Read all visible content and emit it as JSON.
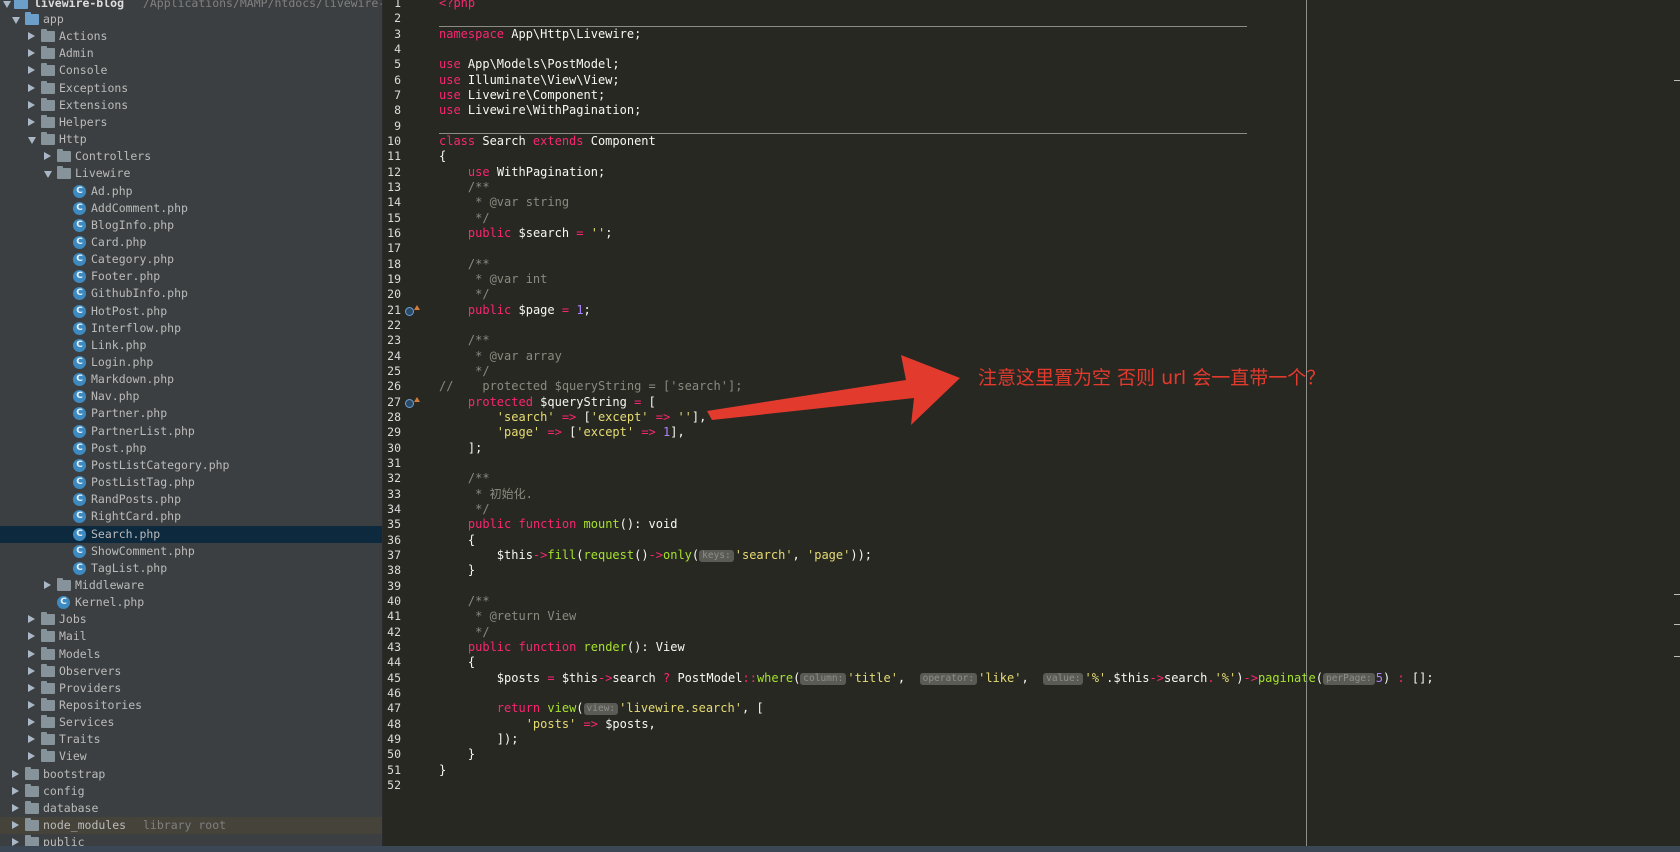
{
  "project": {
    "name": "livewire-blog",
    "path": "/Applications/MAMP/htdocs/livewire-blog"
  },
  "tree": [
    {
      "label": "app",
      "type": "folder",
      "depth": 0,
      "open": true
    },
    {
      "label": "Actions",
      "type": "folder",
      "depth": 1
    },
    {
      "label": "Admin",
      "type": "folder",
      "depth": 1
    },
    {
      "label": "Console",
      "type": "folder",
      "depth": 1
    },
    {
      "label": "Exceptions",
      "type": "folder",
      "depth": 1
    },
    {
      "label": "Extensions",
      "type": "folder",
      "depth": 1
    },
    {
      "label": "Helpers",
      "type": "folder",
      "depth": 1
    },
    {
      "label": "Http",
      "type": "folder",
      "depth": 1,
      "open": true
    },
    {
      "label": "Controllers",
      "type": "folder",
      "depth": 2
    },
    {
      "label": "Livewire",
      "type": "folder",
      "depth": 2,
      "open": true
    },
    {
      "label": "Ad.php",
      "type": "file",
      "depth": 3
    },
    {
      "label": "AddComment.php",
      "type": "file",
      "depth": 3
    },
    {
      "label": "BlogInfo.php",
      "type": "file",
      "depth": 3
    },
    {
      "label": "Card.php",
      "type": "file",
      "depth": 3
    },
    {
      "label": "Category.php",
      "type": "file",
      "depth": 3
    },
    {
      "label": "Footer.php",
      "type": "file",
      "depth": 3
    },
    {
      "label": "GithubInfo.php",
      "type": "file",
      "depth": 3
    },
    {
      "label": "HotPost.php",
      "type": "file",
      "depth": 3
    },
    {
      "label": "Interflow.php",
      "type": "file",
      "depth": 3
    },
    {
      "label": "Link.php",
      "type": "file",
      "depth": 3
    },
    {
      "label": "Login.php",
      "type": "file",
      "depth": 3
    },
    {
      "label": "Markdown.php",
      "type": "file",
      "depth": 3
    },
    {
      "label": "Nav.php",
      "type": "file",
      "depth": 3
    },
    {
      "label": "Partner.php",
      "type": "file",
      "depth": 3
    },
    {
      "label": "PartnerList.php",
      "type": "file",
      "depth": 3
    },
    {
      "label": "Post.php",
      "type": "file",
      "depth": 3
    },
    {
      "label": "PostListCategory.php",
      "type": "file",
      "depth": 3
    },
    {
      "label": "PostListTag.php",
      "type": "file",
      "depth": 3
    },
    {
      "label": "RandPosts.php",
      "type": "file",
      "depth": 3
    },
    {
      "label": "RightCard.php",
      "type": "file",
      "depth": 3
    },
    {
      "label": "Search.php",
      "type": "file",
      "depth": 3,
      "selected": true
    },
    {
      "label": "ShowComment.php",
      "type": "file",
      "depth": 3
    },
    {
      "label": "TagList.php",
      "type": "file",
      "depth": 3
    },
    {
      "label": "Middleware",
      "type": "folder",
      "depth": 2
    },
    {
      "label": "Kernel.php",
      "type": "file",
      "depth": 2
    },
    {
      "label": "Jobs",
      "type": "folder",
      "depth": 1
    },
    {
      "label": "Mail",
      "type": "folder",
      "depth": 1
    },
    {
      "label": "Models",
      "type": "folder",
      "depth": 1
    },
    {
      "label": "Observers",
      "type": "folder",
      "depth": 1
    },
    {
      "label": "Providers",
      "type": "folder",
      "depth": 1
    },
    {
      "label": "Repositories",
      "type": "folder",
      "depth": 1
    },
    {
      "label": "Services",
      "type": "folder",
      "depth": 1
    },
    {
      "label": "Traits",
      "type": "folder",
      "depth": 1
    },
    {
      "label": "View",
      "type": "folder",
      "depth": 1
    },
    {
      "label": "bootstrap",
      "type": "folder",
      "depth": 0
    },
    {
      "label": "config",
      "type": "folder",
      "depth": 0
    },
    {
      "label": "database",
      "type": "folder",
      "depth": 0
    },
    {
      "label": "node_modules",
      "type": "folder",
      "depth": 0,
      "extra": "library root",
      "libroot": true
    },
    {
      "label": "public",
      "type": "folder",
      "depth": 0
    }
  ],
  "code": [
    [
      {
        "t": "<?php",
        "c": "kw"
      }
    ],
    [],
    [
      {
        "t": "namespace",
        "c": "kw"
      },
      {
        "t": " App\\Http\\Livewire;"
      }
    ],
    [],
    [
      {
        "t": "use",
        "c": "kw"
      },
      {
        "t": " App\\Models\\PostModel;"
      }
    ],
    [
      {
        "t": "use",
        "c": "kw"
      },
      {
        "t": " Illuminate\\View\\View;"
      }
    ],
    [
      {
        "t": "use",
        "c": "kw"
      },
      {
        "t": " Livewire\\Component;"
      }
    ],
    [
      {
        "t": "use",
        "c": "kw"
      },
      {
        "t": " Livewire\\WithPagination;"
      }
    ],
    [],
    [
      {
        "t": "class",
        "c": "kw"
      },
      {
        "t": " Search "
      },
      {
        "t": "extends",
        "c": "kw"
      },
      {
        "t": " Component"
      }
    ],
    [
      {
        "t": "{"
      }
    ],
    [
      {
        "t": "    "
      },
      {
        "t": "use",
        "c": "kw"
      },
      {
        "t": " WithPagination;"
      }
    ],
    [
      {
        "t": "    /**",
        "c": "cm"
      }
    ],
    [
      {
        "t": "     * @var string",
        "c": "cm"
      }
    ],
    [
      {
        "t": "     */",
        "c": "cm"
      }
    ],
    [
      {
        "t": "    "
      },
      {
        "t": "public",
        "c": "kw"
      },
      {
        "t": " $search "
      },
      {
        "t": "=",
        "c": "op"
      },
      {
        "t": " "
      },
      {
        "t": "''",
        "c": "str"
      },
      {
        "t": ";"
      }
    ],
    [],
    [
      {
        "t": "    /**",
        "c": "cm"
      }
    ],
    [
      {
        "t": "     * @var int",
        "c": "cm"
      }
    ],
    [
      {
        "t": "     */",
        "c": "cm"
      }
    ],
    [
      {
        "t": "    "
      },
      {
        "t": "public",
        "c": "kw"
      },
      {
        "t": " $page "
      },
      {
        "t": "=",
        "c": "op"
      },
      {
        "t": " "
      },
      {
        "t": "1",
        "c": "num"
      },
      {
        "t": ";"
      }
    ],
    [],
    [
      {
        "t": "    /**",
        "c": "cm"
      }
    ],
    [
      {
        "t": "     * @var array",
        "c": "cm"
      }
    ],
    [
      {
        "t": "     */",
        "c": "cm"
      }
    ],
    [
      {
        "t": "//    protected $queryString = ['search'];",
        "c": "cm"
      }
    ],
    [
      {
        "t": "    "
      },
      {
        "t": "protected",
        "c": "kw"
      },
      {
        "t": " $queryString "
      },
      {
        "t": "=",
        "c": "op"
      },
      {
        "t": " ["
      }
    ],
    [
      {
        "t": "        "
      },
      {
        "t": "'search'",
        "c": "str"
      },
      {
        "t": " "
      },
      {
        "t": "=>",
        "c": "op"
      },
      {
        "t": " ["
      },
      {
        "t": "'except'",
        "c": "str"
      },
      {
        "t": " "
      },
      {
        "t": "=>",
        "c": "op"
      },
      {
        "t": " "
      },
      {
        "t": "''",
        "c": "str"
      },
      {
        "t": "],"
      }
    ],
    [
      {
        "t": "        "
      },
      {
        "t": "'page'",
        "c": "str"
      },
      {
        "t": " "
      },
      {
        "t": "=>",
        "c": "op"
      },
      {
        "t": " ["
      },
      {
        "t": "'except'",
        "c": "str"
      },
      {
        "t": " "
      },
      {
        "t": "=>",
        "c": "op"
      },
      {
        "t": " "
      },
      {
        "t": "1",
        "c": "num"
      },
      {
        "t": "],"
      }
    ],
    [
      {
        "t": "    ];"
      }
    ],
    [],
    [
      {
        "t": "    /**",
        "c": "cm"
      }
    ],
    [
      {
        "t": "     * 初始化.",
        "c": "cm"
      }
    ],
    [
      {
        "t": "     */",
        "c": "cm"
      }
    ],
    [
      {
        "t": "    "
      },
      {
        "t": "public",
        "c": "kw"
      },
      {
        "t": " "
      },
      {
        "t": "function",
        "c": "kw"
      },
      {
        "t": " "
      },
      {
        "t": "mount",
        "c": "fn"
      },
      {
        "t": "(): void"
      }
    ],
    [
      {
        "t": "    {"
      }
    ],
    [
      {
        "t": "        $this"
      },
      {
        "t": "->",
        "c": "op"
      },
      {
        "t": "fill",
        "c": "fn"
      },
      {
        "t": "("
      },
      {
        "t": "request",
        "c": "fn"
      },
      {
        "t": "()"
      },
      {
        "t": "->",
        "c": "op"
      },
      {
        "t": "only",
        "c": "fn"
      },
      {
        "t": "("
      },
      {
        "t": "keys:",
        "c": "hint"
      },
      {
        "t": "'search'",
        "c": "str"
      },
      {
        "t": ", "
      },
      {
        "t": "'page'",
        "c": "str"
      },
      {
        "t": "));"
      }
    ],
    [
      {
        "t": "    }"
      }
    ],
    [],
    [
      {
        "t": "    /**",
        "c": "cm"
      }
    ],
    [
      {
        "t": "     * @return View",
        "c": "cm"
      }
    ],
    [
      {
        "t": "     */",
        "c": "cm"
      }
    ],
    [
      {
        "t": "    "
      },
      {
        "t": "public",
        "c": "kw"
      },
      {
        "t": " "
      },
      {
        "t": "function",
        "c": "kw"
      },
      {
        "t": " "
      },
      {
        "t": "render",
        "c": "fn"
      },
      {
        "t": "(): View"
      }
    ],
    [
      {
        "t": "    {"
      }
    ],
    [
      {
        "t": "        $posts "
      },
      {
        "t": "=",
        "c": "op"
      },
      {
        "t": " $this"
      },
      {
        "t": "->",
        "c": "op"
      },
      {
        "t": "search "
      },
      {
        "t": "?",
        "c": "op"
      },
      {
        "t": " PostModel"
      },
      {
        "t": "::",
        "c": "op"
      },
      {
        "t": "where",
        "c": "fn"
      },
      {
        "t": "("
      },
      {
        "t": "column:",
        "c": "hint"
      },
      {
        "t": "'title'",
        "c": "str"
      },
      {
        "t": ",  "
      },
      {
        "t": "operator:",
        "c": "hint"
      },
      {
        "t": "'like'",
        "c": "str"
      },
      {
        "t": ",  "
      },
      {
        "t": "value:",
        "c": "hint"
      },
      {
        "t": "'%'",
        "c": "str"
      },
      {
        "t": "."
      },
      {
        "t": "$this"
      },
      {
        "t": "->",
        "c": "op"
      },
      {
        "t": "search"
      },
      {
        "t": ".",
        "c": "op"
      },
      {
        "t": "'%'",
        "c": "str"
      },
      {
        "t": ")"
      },
      {
        "t": "->",
        "c": "op"
      },
      {
        "t": "paginate",
        "c": "fn"
      },
      {
        "t": "("
      },
      {
        "t": "perPage:",
        "c": "hint"
      },
      {
        "t": "5",
        "c": "num"
      },
      {
        "t": ") "
      },
      {
        "t": ":",
        "c": "op"
      },
      {
        "t": " [];"
      }
    ],
    [],
    [
      {
        "t": "        "
      },
      {
        "t": "return",
        "c": "kw"
      },
      {
        "t": " "
      },
      {
        "t": "view",
        "c": "fn"
      },
      {
        "t": "("
      },
      {
        "t": "view:",
        "c": "hint"
      },
      {
        "t": "'livewire.search'",
        "c": "str"
      },
      {
        "t": ", ["
      }
    ],
    [
      {
        "t": "            "
      },
      {
        "t": "'posts'",
        "c": "str"
      },
      {
        "t": " "
      },
      {
        "t": "=>",
        "c": "op"
      },
      {
        "t": " $posts,"
      }
    ],
    [
      {
        "t": "        ]);"
      }
    ],
    [
      {
        "t": "    }"
      }
    ],
    [
      {
        "t": "}"
      }
    ],
    []
  ],
  "gutter_marks": [
    21,
    27
  ],
  "separators_after": [
    2,
    9
  ],
  "annotation": {
    "text": "注意这里置为空 否则 url 会一直带一个？",
    "color": "#e33a2e"
  }
}
